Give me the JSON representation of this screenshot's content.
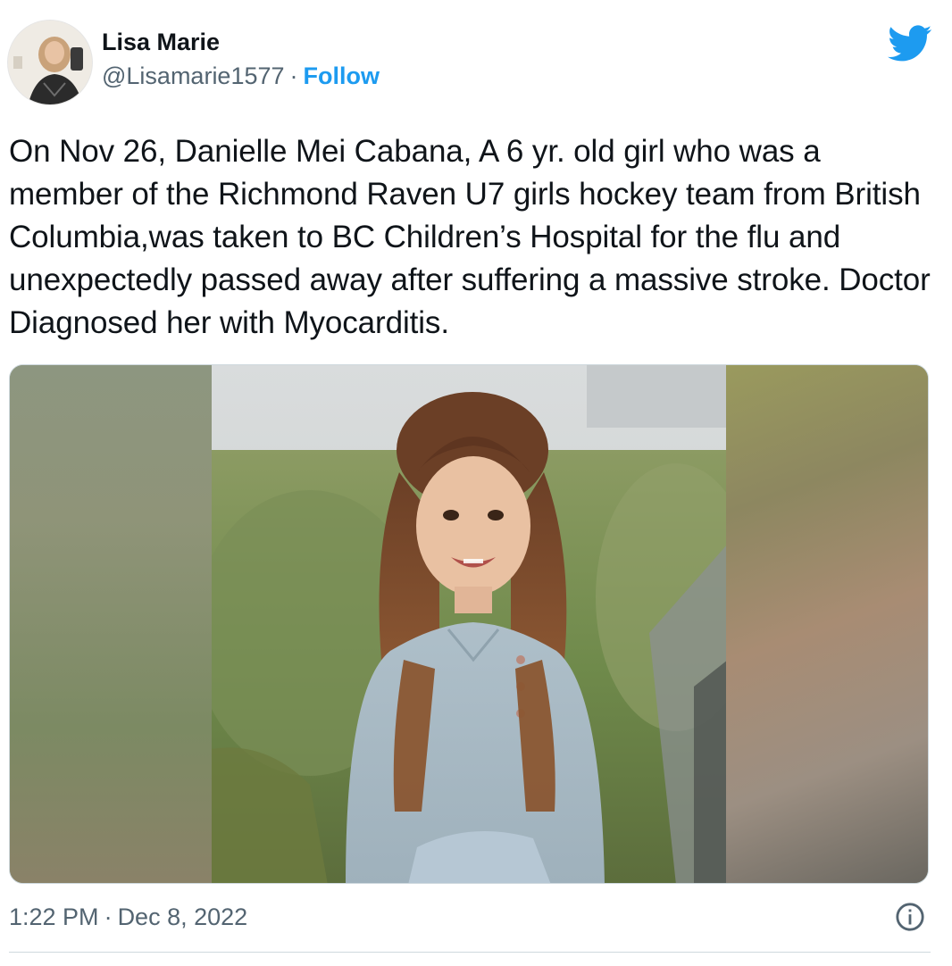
{
  "author": {
    "display_name": "Lisa Marie",
    "handle": "@Lisamarie1577",
    "separator": "·",
    "follow_label": "Follow"
  },
  "tweet": {
    "text": "On Nov 26, Danielle Mei Cabana, A 6 yr. old girl who was a member of the Richmond Raven U7 girls hockey team from British Columbia,was taken to BC Children’s Hospital for the flu and unexpectedly passed away after suffering a massive stroke. Doctor Diagnosed her with Myocarditis.",
    "time": "1:22 PM",
    "separator": "·",
    "date": "Dec 8, 2022"
  },
  "icons": {
    "brand": "twitter-bird-icon",
    "info": "info-icon",
    "brand_color": "#1d9bf0"
  },
  "colors": {
    "text_primary": "#0f1419",
    "text_secondary": "#536471",
    "accent": "#1d9bf0",
    "border": "#cfd9de"
  }
}
